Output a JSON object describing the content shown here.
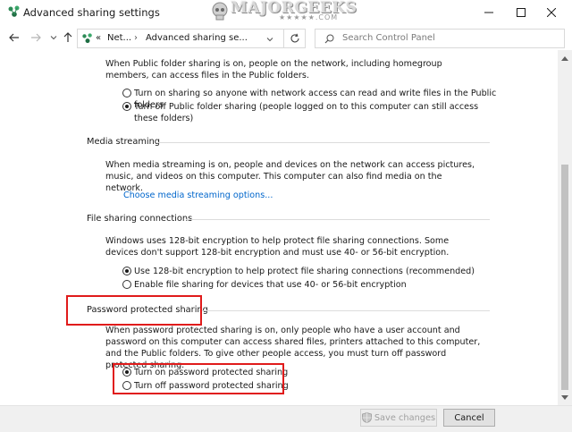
{
  "window": {
    "title": "Advanced sharing settings",
    "watermark_text": "MAJORGEEKS",
    "watermark_sub": "★★★★★.COM"
  },
  "address": {
    "overflow": "«",
    "crumb1": "Net...",
    "crumb2": "Advanced sharing se...",
    "search_placeholder": "Search Control Panel"
  },
  "public_folder": {
    "description": "When Public folder sharing is on, people on the network, including homegroup members, can access files in the Public folders.",
    "options": [
      {
        "label": "Turn on sharing so anyone with network access can read and write files in the Public folders",
        "checked": false
      },
      {
        "label": "Turn off Public folder sharing (people logged on to this computer can still access these folders)",
        "checked": true
      }
    ]
  },
  "media_streaming": {
    "title": "Media streaming",
    "description": "When media streaming is on, people and devices on the network can access pictures, music, and videos on this computer. This computer can also find media on the network.",
    "link": "Choose media streaming options..."
  },
  "file_sharing": {
    "title": "File sharing connections",
    "description": "Windows uses 128-bit encryption to help protect file sharing connections. Some devices don't support 128-bit encryption and must use 40- or 56-bit encryption.",
    "options": [
      {
        "label": "Use 128-bit encryption to help protect file sharing connections (recommended)",
        "checked": true
      },
      {
        "label": "Enable file sharing for devices that use 40- or 56-bit encryption",
        "checked": false
      }
    ]
  },
  "password": {
    "title": "Password protected sharing",
    "description": "When password protected sharing is on, only people who have a user account and password on this computer can access shared files, printers attached to this computer, and the Public folders. To give other people access, you must turn off password protected sharing.",
    "options": [
      {
        "label": "Turn on password protected sharing",
        "checked": true
      },
      {
        "label": "Turn off password protected sharing",
        "checked": false
      }
    ]
  },
  "footer": {
    "save_label": "Save changes",
    "cancel_label": "Cancel"
  },
  "colors": {
    "highlight": "#e01b1b",
    "link": "#0066cc"
  }
}
